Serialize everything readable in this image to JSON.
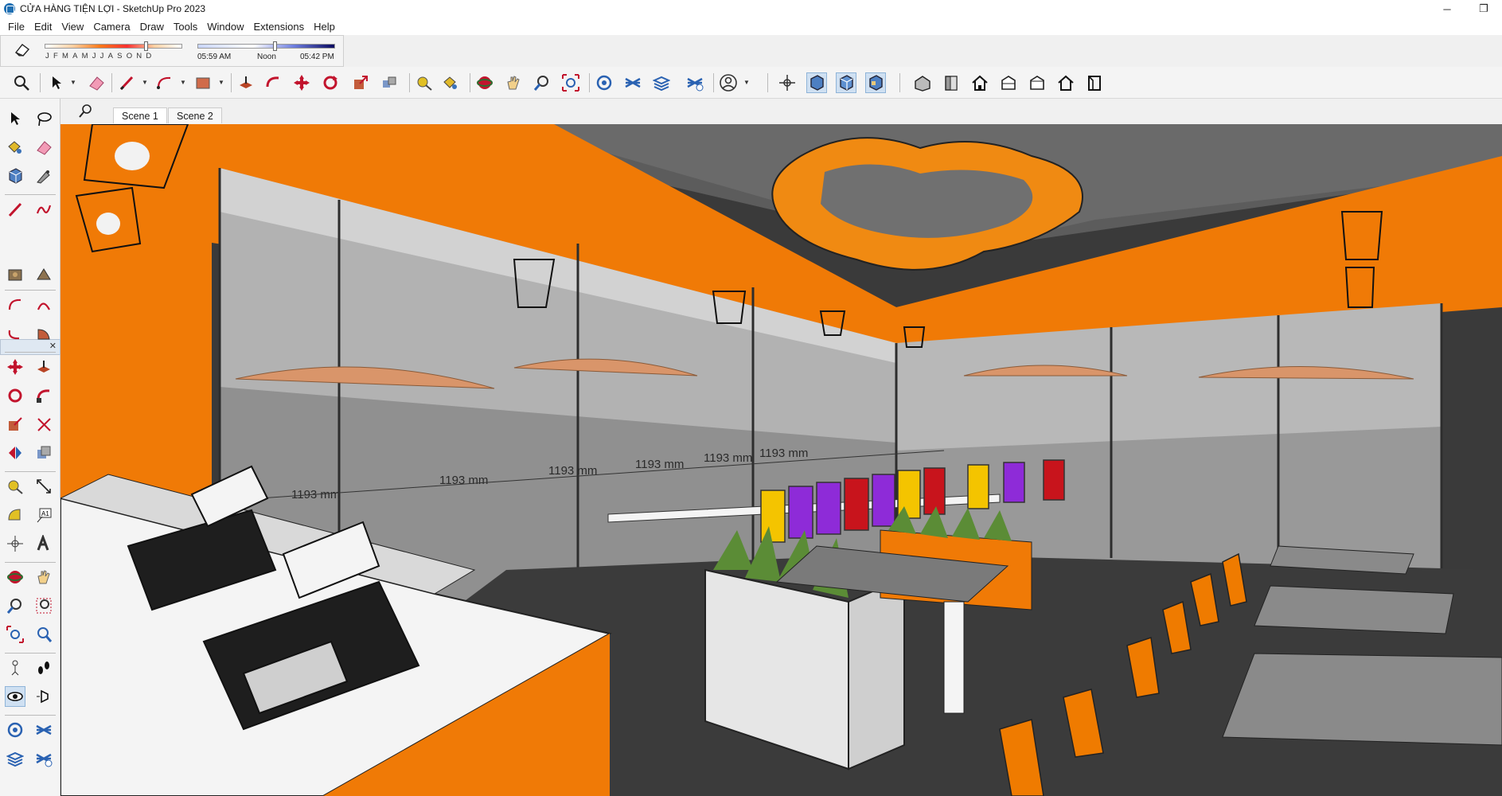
{
  "window": {
    "title": "CỬA HÀNG TIỆN LỢI - SketchUp Pro 2023",
    "minimize_glyph": "─",
    "restore_glyph": "❐"
  },
  "menu": {
    "items": [
      "File",
      "Edit",
      "View",
      "Camera",
      "Draw",
      "Tools",
      "Window",
      "Extensions",
      "Help"
    ]
  },
  "shadows": {
    "months": "JFMAMJJASOND",
    "time_start": "05:59 AM",
    "time_mid": "Noon",
    "time_end": "05:42 PM",
    "icon": "eraser-icon"
  },
  "scenes": {
    "tabs": [
      "Scene 1",
      "Scene 2"
    ],
    "active": "Scene 1"
  },
  "dimensions": {
    "label": "1193 mm"
  },
  "colors": {
    "accent_orange": "#ef7b00",
    "wall_orange": "#f07a06",
    "floor": "#3b3b3b",
    "glass": "#a9a9a9",
    "chair_purple": "#8e2bd8",
    "chair_yellow": "#f4c400",
    "chair_red": "#c8141c"
  },
  "toolbar_icons": [
    "search-icon",
    "select-icon",
    "eraser-icon",
    "pencil-icon",
    "arc-icon",
    "rectangle-icon",
    "push-pull-icon",
    "follow-me-icon",
    "move-icon",
    "rotate-icon",
    "scale-icon",
    "offset-icon",
    "tape-measure-icon",
    "paint-bucket-icon",
    "orbit-icon",
    "pan-icon",
    "zoom-icon",
    "zoom-extents-icon",
    "warehouse-icon",
    "extension-icon",
    "layers-icon",
    "sandbox-icon",
    "account-icon",
    "axes-icon",
    "xray-icon",
    "back-edges-icon",
    "wireframe-icon",
    "iso-view-icon",
    "top-view-icon",
    "front-view-icon",
    "right-view-icon",
    "back-view-icon",
    "left-view-icon"
  ]
}
